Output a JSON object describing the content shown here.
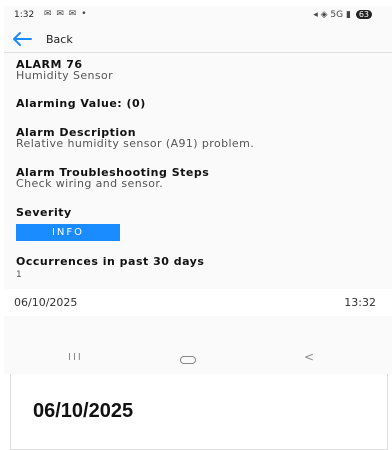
{
  "status_bar": {
    "time": "1:32",
    "notification_icons": "✉ ✉ ✉ •",
    "network": "5G",
    "battery": "63"
  },
  "app_bar": {
    "back_label": "Back"
  },
  "alarm": {
    "title": "ALARM 76",
    "sensor": "Humidity Sensor",
    "alarming_value": "Alarming Value: (0)",
    "description_label": "Alarm Description",
    "description": "Relative humidity sensor (A91) problem.",
    "troubleshooting_label": "Alarm Troubleshooting Steps",
    "troubleshooting": "Check wiring and sensor.",
    "severity_label": "Severity",
    "severity": "INFO",
    "occurrences_label": "Occurrences in past 30 days",
    "occurrences": "1"
  },
  "timestamp": {
    "date": "06/10/2025",
    "time": "13:32"
  },
  "nav_bar": {
    "recent": "III",
    "back": "<"
  },
  "caption": "06/10/2025",
  "colors": {
    "accent": "#1a8cff",
    "severity_badge": "#1a8cff"
  }
}
